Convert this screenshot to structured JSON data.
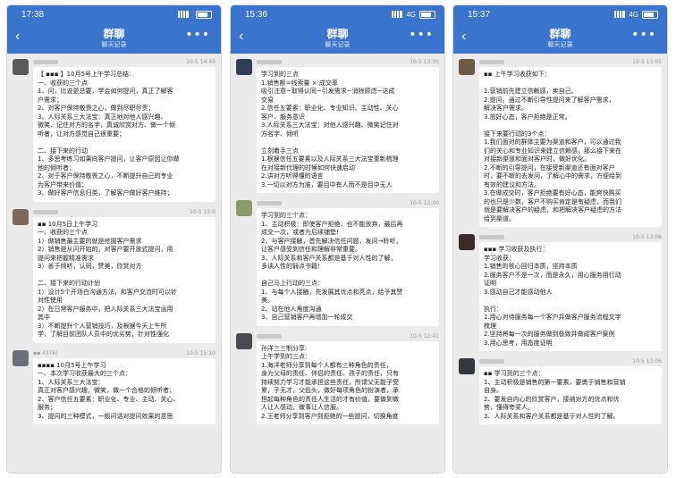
{
  "meta_left": "10-5 14:23",
  "screens": [
    {
      "time": "17:38",
      "network": "",
      "title": "群聊",
      "subtitle": "聊天记录",
      "messages": [
        {
          "avatar_color": "#5a5a5a",
          "sender": "",
          "stamp": "10-5 14:49",
          "lines": [
            "【 ▪▪▪ 】10月5号上午学习总结:",
            "一、收获的三个点",
            "1、问，比说更总要，学会如何提问，真正了解客",
            "户需求；",
            "2、对客户保持敬畏之心，做到尽职尽责；",
            "3、人际关系三大法宝：真正地对他人感兴趣、",
            "微笑、记住对方的名字，真诚欣赏对方、做一个倾",
            "听者，让对方感觉自己很重要；",
            "",
            "二、接下来的行动",
            "1、多思考练习如果向客户提问，让客户原因让你做",
            "他的倾听者；",
            "2、对于客户保持敬畏之心，不断提升自己的专业",
            "为客户带来价值；",
            "3、做好客户信息归类，了解客户做好客户维持；"
          ]
        },
        {
          "avatar_color": "#7a6a5e",
          "sender": "",
          "stamp": "10-5 15:0",
          "lines": [
            "▪▪ 10月5日上午学习",
            "一、收获的三个点",
            "1）做销售最主要的就是挖掘客户需求",
            "2）销售是从问开始的，对客户要开放式提问，用",
            "提问来把握精准需求",
            "3）善于倾听，认同，赞美，欣赏对方",
            "",
            "二、接下来的行动计划",
            "1）设计5个开场白沟通方法，和客户交流时可以针",
            "对性使用",
            "2）在日常客户服务中，把人际关系三大法宝运用",
            "其中",
            "3）不断提升个人营销技巧，及根据今天上午所",
            "学，了解目前团队人员中的优劣势，针对性强化"
          ]
        },
        {
          "avatar_color": "#6b6f78",
          "sender": "▪▪ 4376)",
          "stamp": "10-5 15:10",
          "lines": [
            "▪▪▪▪ 10月5号上午学习",
            "一、本次学习收获最大的三个点：",
            "1、人际关系三大法宝：",
            "真正对客户感兴趣，微笑，做一个合格的倾听者；",
            "2、客户信任五要素：职业化、专业、主动、关心、",
            "服务；",
            "3、提问的三种模式，一般问话对提问效果的意思"
          ]
        }
      ]
    },
    {
      "time": "15:36",
      "network": "4G",
      "title": "群聊",
      "subtitle": "聊天记录",
      "messages": [
        {
          "avatar_color": "#2f3e52",
          "sender": "",
          "stamp": "10-5 13:00",
          "lines": [
            "学习到的三点",
            "1.销售额=线索量 × 成交率",
            "吸引注意~取得认同~引发需求~消除顾虑~达成",
            "交易",
            "2.信任五要素：职业化、专业知识、主动性、关心",
            "客户、服务意识",
            "3.人际关系三大法宝：对他人感兴趣、微笑记住对",
            "方名字、倾听",
            "",
            "立刻着手三点",
            "1.根据信任五要素以及人际关系三大法宝重新梳理",
            "在对接新代理的时候如何快速启动",
            "2.讲对方听得懂的语言",
            "3.一切以对方为准，要目中有人而不是目中无人"
          ]
        },
        {
          "avatar_color": "#8a9a6a",
          "sender": "",
          "stamp": "10-5 13:00",
          "lines": [
            "学习到的三个点：",
            "1、主动积极：即使客户拒绝，也不能放弃，最后再",
            "成交一次，或者为后续铺垫!",
            "2、与客户接触，首先解决信任问题，发问→聆听，",
            "让客户感受到信任和理解非常重要。",
            "3、人际关系和客户关系都是基于对人性的了解，",
            "多读人性的弱点书籍！",
            "",
            "自己马上行动的三点：",
            "1、与每个人接触，先发展其优点和亮点，给予其赞",
            "美。",
            "2、站在他人角度沟通",
            "3、自己营销客户再增加一轮成交"
          ]
        },
        {
          "avatar_color": "#4a4a52",
          "sender": "",
          "stamp": "10-5 12:41",
          "lines": [
            "孙洋三三制分享:",
            "上午学到的三点：",
            "1.海洋老师分享到每个人都有三种角色的责任，",
            "身为父母的责任、伴侣的责任、孩子的责任，只有",
            "持续努力学习才能承担这些责任，所谓父无能子受",
            "累，子无才，父低头，做好每项角色的扮演者，承",
            "担起每种角色的责任人生活的才有价值，要做到做",
            "人让人感动，做事让人信服。",
            "2.王老师分享到客户到拒绝的一些提问，切换角度"
          ]
        }
      ]
    },
    {
      "time": "15:37",
      "network": "4G",
      "title": "群聊",
      "subtitle": "聊天记录",
      "messages": [
        {
          "avatar_color": "#6e5a48",
          "sender": "",
          "stamp": "10-5 13:05",
          "lines": [
            "▪▪ 上午学习收获如下：",
            "",
            "1.营销前先建立信赖感，卖自己。",
            "2.提问。通过不断引导性提问来了解客户需求，",
            "解决客户需求。",
            "3.放好心态，客户拒绝是正常。",
            "",
            "接下来要行动的3个点：",
            "1.我们面对的群体主要为渠道和客户，可以通过我",
            "们的关心和专业知识来建立信赖感，那么接下来在",
            "对接新渠道和面对客户时，做好优化。",
            "2.不断的引导提问，在接受新渠道还有面对客户",
            "时，要不断的去发问，了解心中的需求，方便给到",
            "有效的建议和方法。",
            "3.在做成交时，客户拒绝要有好心态，能爽快购买",
            "的也只是少数，客户不购买肯定是有疑虑，而我们",
            "就是要解决客户的疑虑，和把解决客户疑虑的方法",
            "给到渠道。"
          ]
        },
        {
          "avatar_color": "#3b2c2a",
          "sender": "",
          "stamp": "10-5 13:06",
          "lines": [
            "▪▪▪ 学习收获及执行：",
            "学习收获：",
            "1.销售的核心回归本质，坚持本质",
            "2.服务客户不是一次，而是永久，用心服务用行动",
            "证明",
            "3.感动自己才能感动他人",
            "",
            "执行：",
            "1.用心对待服务每一个客户并做客户服务流程文字",
            "梳理",
            "2.坚持将每一次的服务做到极致并做成客户案例",
            "3.用心思考，用态度证明"
          ]
        },
        {
          "avatar_color": "#34383e",
          "sender": "",
          "stamp": "10-5 13:06",
          "lines": [
            "▪▪ 学习到的三个点：",
            "1、主动积极是销售的第一要素，要勇于销售和营销",
            "自身。",
            "2、要发自内心的欣赏客户，接纳对方的优点和优",
            "势，懂得夸奖人。",
            "3、人际关系和客户关系都是基于对人性的了解。"
          ]
        }
      ]
    }
  ]
}
